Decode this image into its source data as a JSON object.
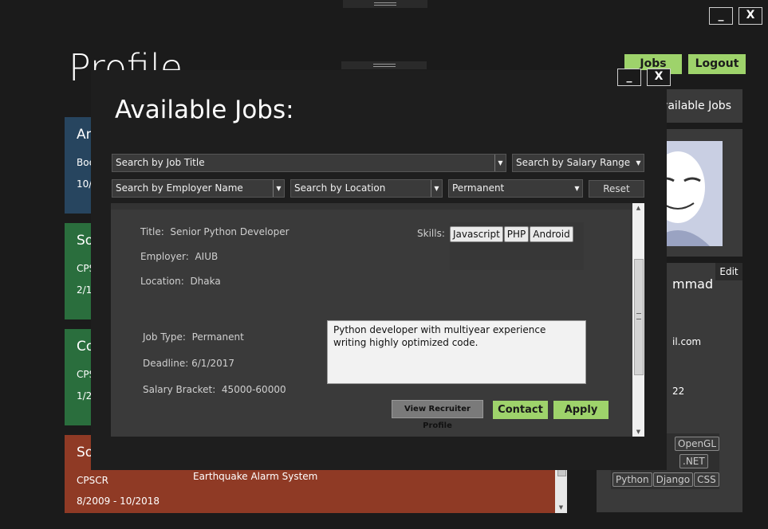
{
  "window": {
    "minimize_label": "_",
    "close_label": "X"
  },
  "profile": {
    "title": "Profile",
    "top_buttons": {
      "jobs_label": "Jobs",
      "logout_label": "Logout"
    },
    "available_jobs_nav": "Available Jobs",
    "edit_label": "Edit",
    "name_fragment": "mmad",
    "email_fragment": "il.com",
    "phone_fragment": "22",
    "skills": [
      "OpenGL",
      ".NET",
      "Python",
      "Django",
      "CSS"
    ]
  },
  "cards": [
    {
      "title": "Am",
      "line1": "Boe",
      "line2": "10/",
      "color": "#27455f"
    },
    {
      "title": "So",
      "line1": "CPS",
      "line2": "2/1",
      "color": "#2a6e3d"
    },
    {
      "title": "Co",
      "line1": "CPS",
      "line2": "1/2",
      "color": "#2a6e3d"
    },
    {
      "title": "So",
      "line1": "CPSCR",
      "line2": "8/2009 - 10/2018",
      "project": "Earthquake Alarm System",
      "color": "#8f3a25"
    }
  ],
  "modal": {
    "title": "Available Jobs:",
    "minimize_label": "_",
    "close_label": "X",
    "filters": {
      "job_title_placeholder": "Search by Job Title",
      "salary_placeholder": "Search by Salary Range",
      "employer_placeholder": "Search by Employer Name",
      "location_placeholder": "Search by Location",
      "job_type_value": "Permanent",
      "reset_label": "Reset"
    },
    "job": {
      "title_label": "Title:",
      "title_value": "Senior Python Developer",
      "employer_label": "Employer:",
      "employer_value": "AIUB",
      "location_label": "Location:",
      "location_value": "Dhaka",
      "skills_label": "Skills:",
      "skills": [
        "Javascript",
        "PHP",
        "Android"
      ],
      "job_type_label": "Job Type:",
      "job_type_value": "Permanent",
      "deadline_label": "Deadline:",
      "deadline_value": "6/1/2017",
      "salary_label": "Salary Bracket:",
      "salary_value": "45000-60000",
      "description": "Python developer with multiyear experience writing highly optimized code.",
      "view_recruiter_label": "View Recruiter Profile",
      "contact_label": "Contact",
      "apply_label": "Apply"
    }
  },
  "icons": {
    "scroll_up": "scroll-up-icon",
    "scroll_down": "scroll-down-icon",
    "scroll_grip": "scroll-grip-icon",
    "avatar": "anonymous-mask-avatar"
  }
}
